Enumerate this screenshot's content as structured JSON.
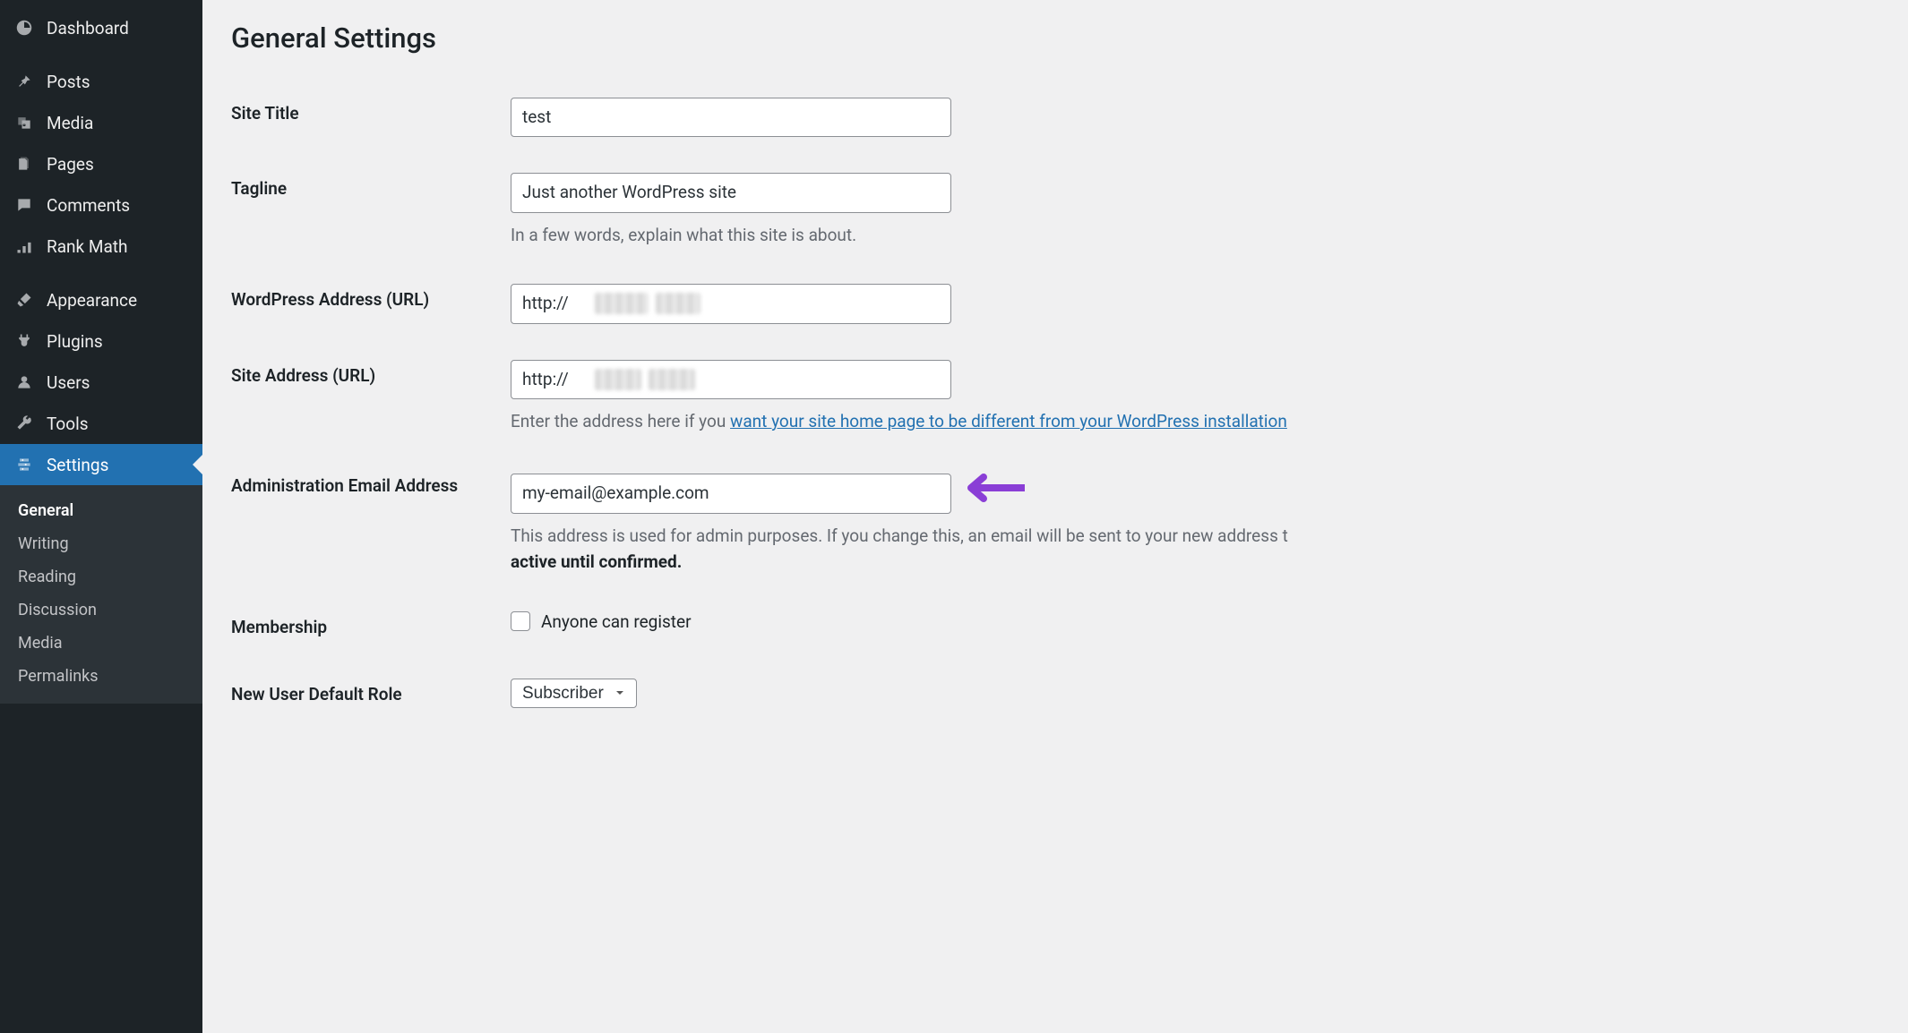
{
  "sidebar": {
    "items": [
      {
        "label": "Dashboard",
        "icon": "dashboard"
      },
      {
        "label": "Posts",
        "icon": "pin"
      },
      {
        "label": "Media",
        "icon": "media"
      },
      {
        "label": "Pages",
        "icon": "pages"
      },
      {
        "label": "Comments",
        "icon": "comment"
      },
      {
        "label": "Rank Math",
        "icon": "rankmath"
      },
      {
        "label": "Appearance",
        "icon": "brush"
      },
      {
        "label": "Plugins",
        "icon": "plug"
      },
      {
        "label": "Users",
        "icon": "user"
      },
      {
        "label": "Tools",
        "icon": "wrench"
      },
      {
        "label": "Settings",
        "icon": "settings",
        "current": true
      }
    ],
    "submenu": [
      {
        "label": "General",
        "active": true
      },
      {
        "label": "Writing"
      },
      {
        "label": "Reading"
      },
      {
        "label": "Discussion"
      },
      {
        "label": "Media"
      },
      {
        "label": "Permalinks"
      }
    ]
  },
  "page": {
    "title": "General Settings",
    "fields": {
      "site_title": {
        "label": "Site Title",
        "value": "test"
      },
      "tagline": {
        "label": "Tagline",
        "value": "Just another WordPress site",
        "desc": "In a few words, explain what this site is about."
      },
      "wp_url": {
        "label": "WordPress Address (URL)",
        "prefix": "http://"
      },
      "site_url": {
        "label": "Site Address (URL)",
        "prefix": "http://",
        "desc_pre": "Enter the address here if you ",
        "desc_link": "want your site home page to be different from your WordPress installation"
      },
      "admin_email": {
        "label": "Administration Email Address",
        "value": "my-email@example.com",
        "desc_a": "This address is used for admin purposes. If you change this, an email will be sent to your new address t",
        "desc_b": "active until confirmed."
      },
      "membership": {
        "label": "Membership",
        "checkbox_label": "Anyone can register",
        "checked": false
      },
      "default_role": {
        "label": "New User Default Role",
        "value": "Subscriber"
      }
    }
  }
}
